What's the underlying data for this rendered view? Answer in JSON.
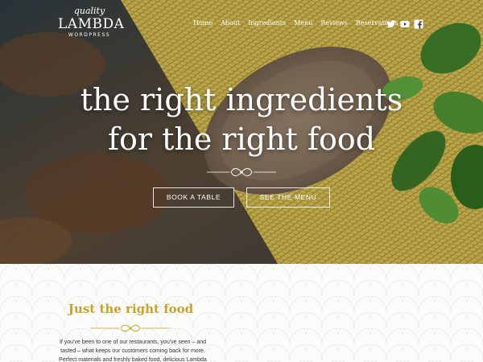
{
  "logo": {
    "top_text": "quality",
    "name": "LAMBDA",
    "sub_text": "WORDPRESS"
  },
  "nav": {
    "items": [
      "Home",
      "About",
      "Ingredients",
      "Menu",
      "Reviews",
      "Reservations"
    ]
  },
  "social": {
    "icons": [
      "twitter-icon",
      "youtube-icon",
      "facebook-icon"
    ]
  },
  "hero": {
    "headline_line1": "the right ingredients",
    "headline_line2": "for the right food",
    "book_button": "BOOK A TABLE",
    "menu_button": "SEE THE MENU"
  },
  "content": {
    "title": "Just the right food",
    "paragraph_lines": [
      "If you've been to one of our restaurants, you've seen – and",
      "tasted – what keeps our customers coming back for more.",
      "Perfect materials and freshly baked food, delicious Lambda"
    ]
  },
  "colors": {
    "accent": "#c9a227",
    "hero_text": "#ffffff",
    "body_text": "#333333"
  }
}
